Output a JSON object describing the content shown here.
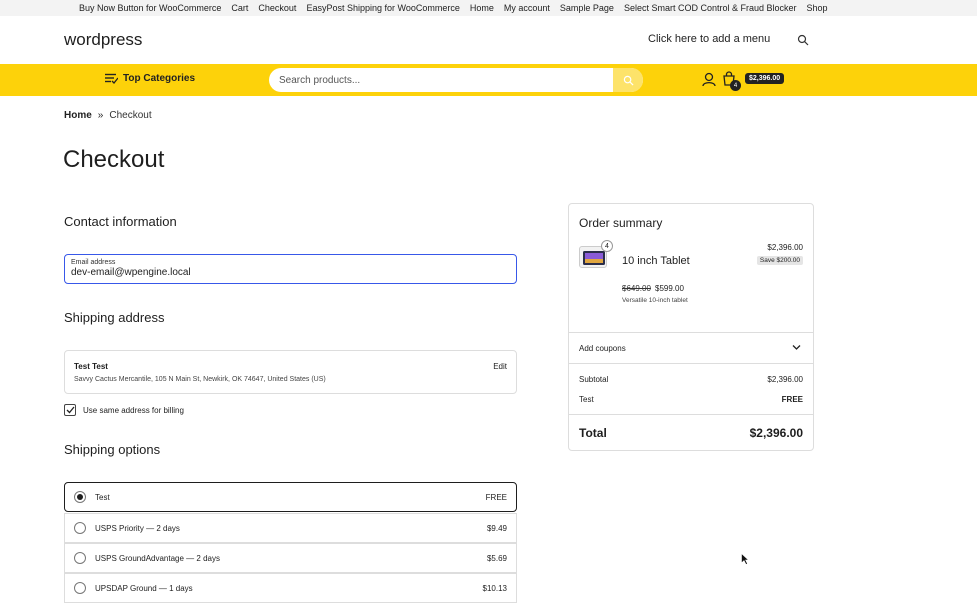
{
  "topnav": [
    "Buy Now Button for WooCommerce",
    "Cart",
    "Checkout",
    "EasyPost Shipping for WooCommerce",
    "Home",
    "My account",
    "Sample Page",
    "Select Smart COD Control & Fraud Blocker",
    "Shop"
  ],
  "header": {
    "site_title": "wordpress",
    "add_menu": "Click here to add a menu",
    "search_icon": "search-icon"
  },
  "bar": {
    "top_categories": "Top Categories",
    "search_placeholder": "Search products...",
    "cart_count": "4",
    "cart_total": "$2,396.00",
    "accent": "#fdd20a"
  },
  "breadcrumb": {
    "home": "Home",
    "current": "Checkout"
  },
  "page_title": "Checkout",
  "contact": {
    "title": "Contact information",
    "email_label": "Email address",
    "email_value": "dev-email@wpengine.local"
  },
  "shipping_address": {
    "title": "Shipping address",
    "name": "Test Test",
    "address": "Savvy Cactus Mercantile, 105 N Main St, Newkirk, OK 74647, United States (US)",
    "edit": "Edit",
    "same_billing": "Use same address for billing"
  },
  "shipping_options": {
    "title": "Shipping options",
    "options": [
      {
        "label": "Test",
        "price": "FREE",
        "selected": true
      },
      {
        "label": "USPS Priority — 2 days",
        "price": "$9.49",
        "selected": false
      },
      {
        "label": "USPS GroundAdvantage — 2 days",
        "price": "$5.69",
        "selected": false
      },
      {
        "label": "UPSDAP Ground — 1 days",
        "price": "$10.13",
        "selected": false
      }
    ]
  },
  "summary": {
    "title": "Order summary",
    "qty": "4",
    "product_name": "10 inch Tablet",
    "product_total": "$2,396.00",
    "save": "Save $200.00",
    "old_price": "$649.00",
    "new_price": "$599.00",
    "description": "Versatile 10-inch tablet",
    "coupons": "Add coupons",
    "subtotal_label": "Subtotal",
    "subtotal_value": "$2,396.00",
    "ship_label": "Test",
    "ship_value": "FREE",
    "total_label": "Total",
    "total_value": "$2,396.00"
  }
}
